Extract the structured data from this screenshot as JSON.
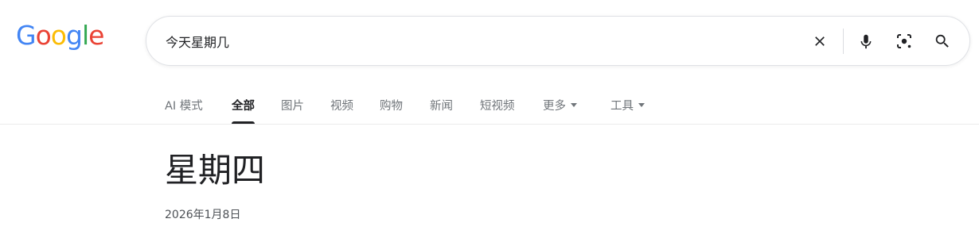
{
  "logo": {
    "letters": [
      {
        "char": "G",
        "color": "#4285F4"
      },
      {
        "char": "o",
        "color": "#EA4335"
      },
      {
        "char": "o",
        "color": "#FBBC05"
      },
      {
        "char": "g",
        "color": "#4285F4"
      },
      {
        "char": "l",
        "color": "#34A853"
      },
      {
        "char": "e",
        "color": "#EA4335"
      }
    ]
  },
  "search": {
    "value": "今天星期几",
    "icons": [
      "clear-icon",
      "microphone-icon",
      "google-lens-icon",
      "search-icon"
    ]
  },
  "tabs": {
    "ai": "AI 模式",
    "all": "全部",
    "images": "图片",
    "videos": "视频",
    "shopping": "购物",
    "news": "新闻",
    "short_videos": "短视频",
    "more": "更多",
    "tools": "工具",
    "active": "all"
  },
  "result": {
    "day": "星期四",
    "date": "2026年1月8日"
  },
  "colors": {
    "accent_blue": "#4285F4",
    "text_primary": "#202124",
    "text_secondary": "#70757a"
  }
}
